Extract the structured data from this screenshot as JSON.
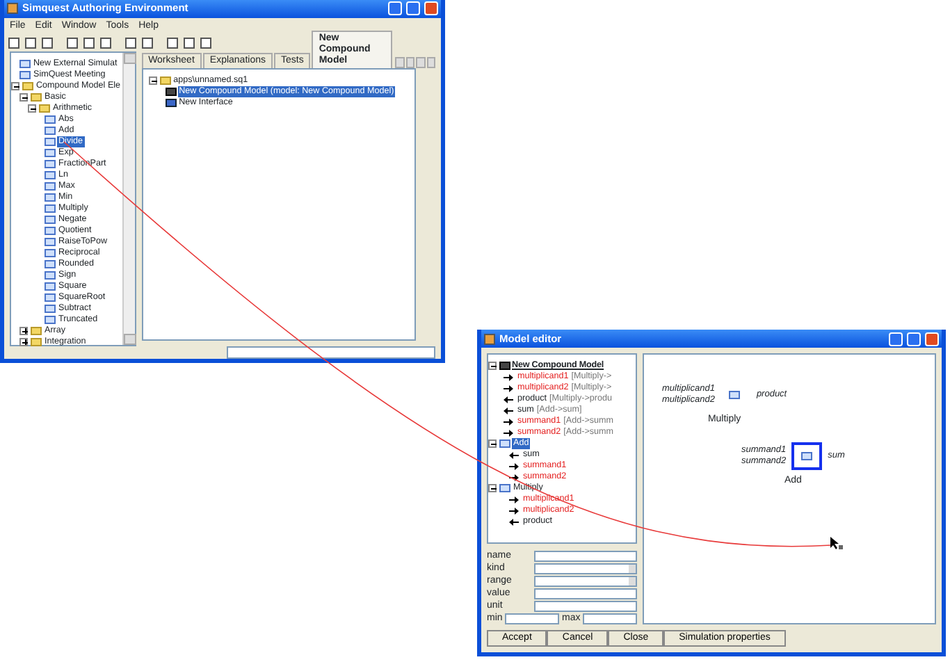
{
  "main_window": {
    "title": "Simquest Authoring Environment",
    "menu": [
      "File",
      "Edit",
      "Window",
      "Tools",
      "Help"
    ],
    "tree": [
      {
        "label": "New External Simulat",
        "kind": "simulation",
        "selected": false
      },
      {
        "label": "SimQuest Meeting",
        "kind": "meeting",
        "selected": false
      },
      {
        "label": "Compound Model Ele",
        "kind": "folder",
        "selected": false,
        "expanded": true,
        "children": [
          {
            "label": "Basic",
            "kind": "folder",
            "selected": false,
            "expanded": true,
            "children": [
              {
                "label": "Arithmetic",
                "kind": "folder",
                "selected": false,
                "expanded": true,
                "children": [
                  {
                    "label": "Abs",
                    "kind": "function",
                    "selected": false
                  },
                  {
                    "label": "Add",
                    "kind": "function",
                    "selected": false
                  },
                  {
                    "label": "Divide",
                    "kind": "function",
                    "selected": true
                  },
                  {
                    "label": "Exp",
                    "kind": "function",
                    "selected": false
                  },
                  {
                    "label": "FractionPart",
                    "kind": "function",
                    "selected": false
                  },
                  {
                    "label": "Ln",
                    "kind": "function",
                    "selected": false
                  },
                  {
                    "label": "Max",
                    "kind": "function",
                    "selected": false
                  },
                  {
                    "label": "Min",
                    "kind": "function",
                    "selected": false
                  },
                  {
                    "label": "Multiply",
                    "kind": "function",
                    "selected": false
                  },
                  {
                    "label": "Negate",
                    "kind": "function",
                    "selected": false
                  },
                  {
                    "label": "Quotient",
                    "kind": "function",
                    "selected": false
                  },
                  {
                    "label": "RaiseToPow",
                    "kind": "function",
                    "selected": false
                  },
                  {
                    "label": "Reciprocal",
                    "kind": "function",
                    "selected": false
                  },
                  {
                    "label": "Rounded",
                    "kind": "function",
                    "selected": false
                  },
                  {
                    "label": "Sign",
                    "kind": "function",
                    "selected": false
                  },
                  {
                    "label": "Square",
                    "kind": "function",
                    "selected": false
                  },
                  {
                    "label": "SquareRoot",
                    "kind": "function",
                    "selected": false
                  },
                  {
                    "label": "Subtract",
                    "kind": "function",
                    "selected": false
                  },
                  {
                    "label": "Truncated",
                    "kind": "function",
                    "selected": false
                  }
                ]
              }
            ]
          },
          {
            "label": "Array",
            "kind": "folder",
            "selected": false,
            "expanded": false
          },
          {
            "label": "Integration",
            "kind": "folder",
            "selected": false,
            "expanded": false
          }
        ]
      }
    ],
    "tabs": [
      {
        "label": "Worksheet",
        "selected": false
      },
      {
        "label": "Explanations",
        "selected": false
      },
      {
        "label": "Tests",
        "selected": false
      },
      {
        "label": "New Compound Model",
        "selected": true
      }
    ],
    "file_tree": [
      {
        "label": "apps\\unnamed.sq1",
        "kind": "folder",
        "selected": false,
        "expanded": true,
        "children": [
          {
            "label": "New Compound Model (model: New Compound Model)",
            "kind": "model",
            "selected": true
          },
          {
            "label": "New Interface",
            "kind": "interface",
            "selected": false
          }
        ]
      }
    ]
  },
  "model_editor": {
    "title": "Model editor",
    "root": "New Compound Model",
    "variables": [
      {
        "name": "multiplicand1",
        "ref": "[Multiply->",
        "kind": "input"
      },
      {
        "name": "multiplicand2",
        "ref": "[Multiply->",
        "kind": "input"
      },
      {
        "name": "product",
        "ref": "[Multiply->produ",
        "kind": "output"
      },
      {
        "name": "sum",
        "ref": "[Add->sum]",
        "kind": "output"
      },
      {
        "name": "summand1",
        "ref": "[Add->summ",
        "kind": "input"
      },
      {
        "name": "summand2",
        "ref": "[Add->summ",
        "kind": "input"
      }
    ],
    "components": [
      {
        "label": "Add",
        "selected": true,
        "expanded": true,
        "ports": [
          {
            "name": "sum",
            "kind": "output"
          },
          {
            "name": "summand1",
            "kind": "input"
          },
          {
            "name": "summand2",
            "kind": "input"
          }
        ]
      },
      {
        "label": "Multiply",
        "selected": false,
        "expanded": true,
        "ports": [
          {
            "name": "multiplicand1",
            "kind": "input"
          },
          {
            "name": "multiplicand2",
            "kind": "input"
          },
          {
            "name": "product",
            "kind": "output"
          }
        ]
      }
    ],
    "fields": [
      {
        "label": "name",
        "kind": "text"
      },
      {
        "label": "kind",
        "kind": "select"
      },
      {
        "label": "range",
        "kind": "select"
      },
      {
        "label": "value",
        "kind": "text"
      },
      {
        "label": "unit",
        "kind": "text"
      }
    ],
    "min_label": "min",
    "max_label": "max",
    "blocks": [
      {
        "label": "Multiply",
        "inputs": [
          "multiplicand1",
          "multiplicand2"
        ],
        "output": "product",
        "selected": false
      },
      {
        "label": "Add",
        "inputs": [
          "summand1",
          "summand2"
        ],
        "output": "sum",
        "selected": true
      }
    ],
    "buttons": [
      "Accept",
      "Cancel",
      "Close",
      "Simulation properties"
    ]
  }
}
